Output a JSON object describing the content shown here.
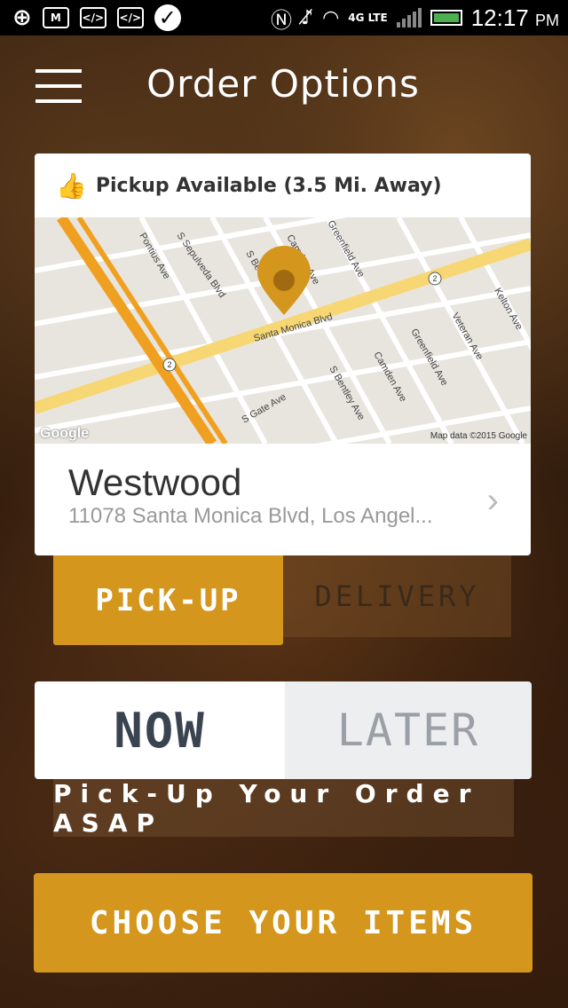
{
  "status_bar": {
    "time": "12:17",
    "ampm": "PM",
    "network": "4G LTE",
    "icons": [
      "add-icon",
      "gmail-icon",
      "code-icon",
      "code-icon",
      "check-icon",
      "nfc-icon",
      "mute-icon",
      "wifi-icon",
      "signal-icon",
      "battery-icon"
    ]
  },
  "header": {
    "title": "Order Options"
  },
  "location_card": {
    "pickup_text": "Pickup Available (3.5 Mi. Away)",
    "map": {
      "attribution": "Map data ©2015 Google",
      "logo": "Google",
      "streets": [
        "Pontius Ave",
        "S Sepulveda Blvd",
        "S Be",
        "Camden Ave",
        "Greenfield Ave",
        "Kelton Ave",
        "Veteran Ave",
        "Santa Monica Blvd",
        "Greenfield Ave",
        "Camden Ave",
        "S Bentley Ave",
        "S Gate Ave"
      ],
      "route_badges": [
        "2",
        "2"
      ]
    },
    "location_name": "Westwood",
    "address": "11078 Santa Monica Blvd, Los Angel..."
  },
  "fulfillment": {
    "pickup_label": "PICK-UP",
    "delivery_label": "DELIVERY",
    "selected": "PICK-UP"
  },
  "timing": {
    "now_label": "NOW",
    "later_label": "LATER",
    "selected": "NOW",
    "note": "Pick-Up Your Order ASAP"
  },
  "cta": {
    "label": "CHOOSE YOUR ITEMS"
  },
  "colors": {
    "accent": "#d4961c",
    "map_road_highway": "#f0a020",
    "map_road_main": "#f7d774"
  }
}
